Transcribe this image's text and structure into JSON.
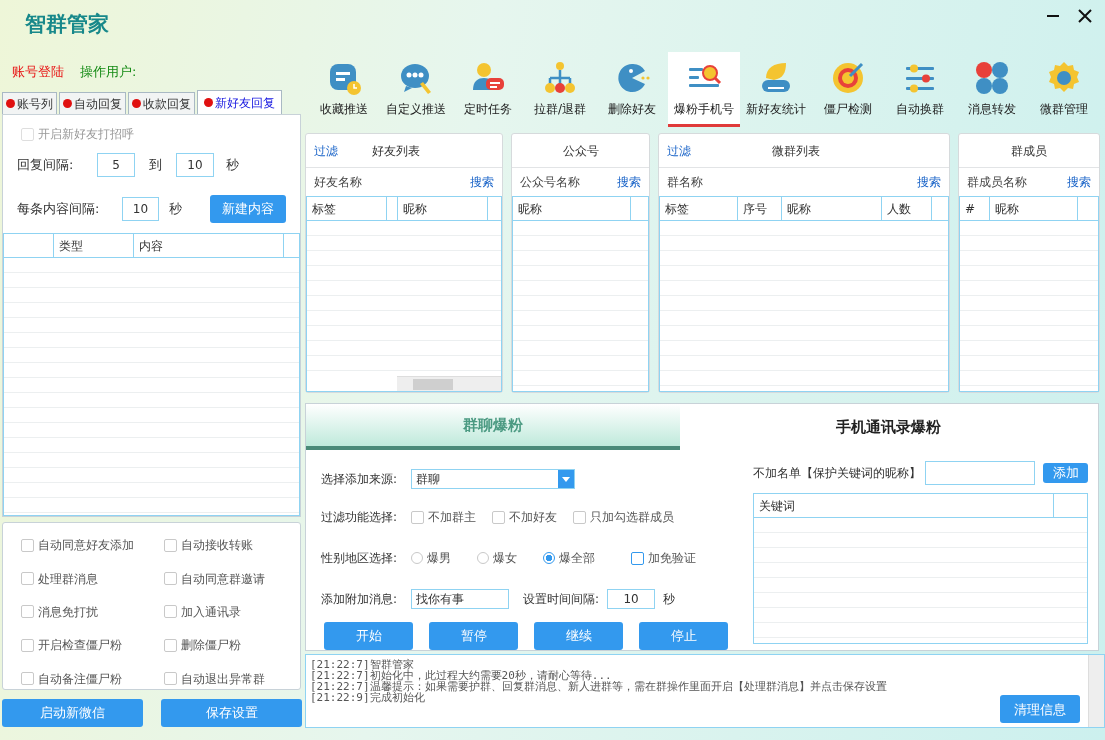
{
  "window": {
    "title": "智群管家"
  },
  "account": {
    "login_label": "账号登陆",
    "operator_label": "操作用户:"
  },
  "left_tabs": [
    {
      "label": "账号列",
      "selected": false
    },
    {
      "label": "自动回复",
      "selected": false
    },
    {
      "label": "收款回复",
      "selected": false
    },
    {
      "label": "新好友回复",
      "selected": true
    }
  ],
  "greeting": {
    "label": "开启新好友打招呼",
    "checked": false,
    "disabled": true
  },
  "reply_interval": {
    "label": "回复间隔:",
    "from": "5",
    "to_label": "到",
    "to": "10",
    "unit": "秒"
  },
  "content_interval": {
    "label": "每条内容间隔:",
    "value": "10",
    "unit": "秒"
  },
  "new_content_button": "新建内容",
  "content_table": {
    "columns": [
      "类型",
      "内容"
    ]
  },
  "options": [
    {
      "label": "自动同意好友添加",
      "checked": false
    },
    {
      "label": "自动接收转账",
      "checked": false
    },
    {
      "label": "处理群消息",
      "checked": false
    },
    {
      "label": "自动同意群邀请",
      "checked": false
    },
    {
      "label": "消息免打扰",
      "checked": false
    },
    {
      "label": "加入通讯录",
      "checked": false
    },
    {
      "label": "开启检查僵尸粉",
      "checked": false
    },
    {
      "label": "删除僵尸粉",
      "checked": false
    },
    {
      "label": "自动备注僵尸粉",
      "checked": false
    },
    {
      "label": "自动退出异常群",
      "checked": false
    }
  ],
  "left_buttons": [
    "启动新微信",
    "保存设置"
  ],
  "toolbar": [
    {
      "label": "收藏推送",
      "selected": false
    },
    {
      "label": "自定义推送",
      "selected": false
    },
    {
      "label": "定时任务",
      "selected": false
    },
    {
      "label": "拉群/退群",
      "selected": false
    },
    {
      "label": "删除好友",
      "selected": false
    },
    {
      "label": "爆粉手机号",
      "selected": true
    },
    {
      "label": "新好友统计",
      "selected": false
    },
    {
      "label": "僵尸检测",
      "selected": false
    },
    {
      "label": "自动换群",
      "selected": false
    },
    {
      "label": "消息转发",
      "selected": false
    },
    {
      "label": "微群管理",
      "selected": false
    }
  ],
  "panels": [
    {
      "filter": "过滤",
      "title": "好友列表",
      "search_label": "好友名称",
      "search_button": "搜索",
      "columns": [
        "标签",
        "昵称"
      ],
      "horizontal_scrollbar": true
    },
    {
      "title": "公众号",
      "search_label": "公众号名称",
      "search_button": "搜索",
      "columns": [
        "昵称"
      ]
    },
    {
      "filter": "过滤",
      "title": "微群列表",
      "search_label": "群名称",
      "search_button": "搜索",
      "columns": [
        "标签",
        "序号",
        "昵称",
        "人数"
      ]
    },
    {
      "title": "群成员",
      "search_label": "群成员名称",
      "search_button": "搜索",
      "columns": [
        "#",
        "昵称"
      ]
    }
  ],
  "bulk_add": {
    "tabs": [
      {
        "label": "群聊爆粉",
        "selected": true
      },
      {
        "label": "手机通讯录爆粉",
        "selected": false
      }
    ],
    "source": {
      "label": "选择添加来源:",
      "value": "群聊"
    },
    "filter": {
      "label": "过滤功能选择:",
      "options": [
        {
          "label": "不加群主",
          "checked": false
        },
        {
          "label": "不加好友",
          "checked": false
        },
        {
          "label": "只加勾选群成员",
          "checked": false
        }
      ]
    },
    "gender": {
      "label": "性别地区选择:",
      "options": [
        {
          "label": "爆男",
          "selected": false
        },
        {
          "label": "爆女",
          "selected": false
        },
        {
          "label": "爆全部",
          "selected": true
        }
      ]
    },
    "no_verify": {
      "label": "加免验证",
      "checked": false
    },
    "message": {
      "label": "添加附加消息:",
      "value": "找你有事"
    },
    "interval": {
      "label": "设置时间间隔:",
      "value": "10",
      "unit": "秒"
    },
    "buttons": [
      "开始",
      "暂停",
      "继续",
      "停止"
    ],
    "exclude": {
      "label": "不加名单【保护关键词的昵称】",
      "add_button": "添加"
    },
    "keyword_table": {
      "columns": [
        "关键词"
      ]
    }
  },
  "log": {
    "lines": [
      "[21:22:7]智群管家",
      "[21:22:7]初始化中，此过程大约需要20秒，请耐心等待...",
      "[21:22:7]温馨提示：如果需要护群、回复群消息、新人进群等，需在群操作里面开启【处理群消息】并点击保存设置",
      "[21:22:9]完成初始化"
    ],
    "clear_button": "清理信息"
  }
}
